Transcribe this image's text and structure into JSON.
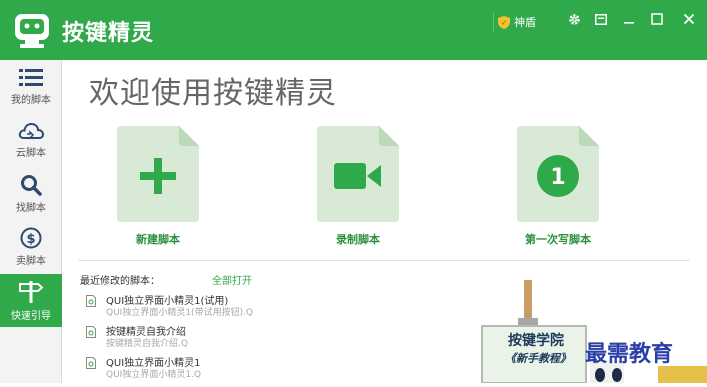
{
  "app": {
    "title": "按键精灵"
  },
  "titlebar": {
    "shield_label": "神盾"
  },
  "sidebar": {
    "items": [
      {
        "label": "我的脚本",
        "icon": "list-icon"
      },
      {
        "label": "云脚本",
        "icon": "cloud-icon"
      },
      {
        "label": "找脚本",
        "icon": "search-icon"
      },
      {
        "label": "卖脚本",
        "icon": "dollar-icon"
      },
      {
        "label": "快速引导",
        "icon": "signpost-icon"
      }
    ],
    "active_index": 4
  },
  "main": {
    "welcome": "欢迎使用按键精灵",
    "actions": [
      {
        "label": "新建脚本",
        "icon": "plus-icon"
      },
      {
        "label": "录制脚本",
        "icon": "video-camera-icon"
      },
      {
        "label": "第一次写脚本",
        "icon": "number-one-icon",
        "icon_text": "1"
      }
    ],
    "recent": {
      "title": "最近修改的脚本：",
      "open_all": "全部打开",
      "items": [
        {
          "name": "QUI独立界面小精灵1(试用)",
          "desc": "QUI独立界面小精灵1(带试用按钮).Q"
        },
        {
          "name": "按键精灵自我介绍",
          "desc": "按键精灵自我介绍.Q"
        },
        {
          "name": "QUI独立界面小精灵1",
          "desc": "QUI独立界面小精灵1.Q"
        }
      ]
    }
  },
  "promo": {
    "sign_line1": "按键学院",
    "sign_line2": "《新手教程》",
    "brand": "最需教育"
  },
  "colors": {
    "brand_green": "#2fa94a",
    "tile_bg": "#d8ead6",
    "shield_yellow": "#f2c230",
    "promo_blue": "#2a3fa8"
  }
}
